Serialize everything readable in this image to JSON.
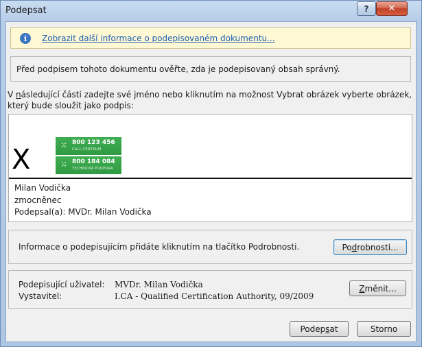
{
  "window": {
    "title": "Podepsat",
    "help_label": "?",
    "close_label": "✕"
  },
  "info_bar": {
    "icon": "info-icon",
    "icon_glyph": "i",
    "link_text": "Zobrazit další informace o podepisovaném dokumentu..."
  },
  "verify_text": "Před podpisem tohoto dokumentu ověřte, zda je podepisovaný obsah správný.",
  "instructions": {
    "prefix": "V ",
    "underlined": "n",
    "rest": "ásledující části zadejte své jméno nebo kliknutím na možnost Vybrat obrázek vyberte obrázek, který bude sloužit jako podpis:"
  },
  "signature": {
    "x_mark": "X",
    "image": {
      "top_number": "800 123 456",
      "top_caption": "CALL CENTRUM",
      "bottom_number": "800 184 084",
      "bottom_caption": "TECHNICKÁ PODPORA",
      "color": "#33a148"
    },
    "lines": [
      "Milan Vodička",
      "zmocněnec",
      "Podepsal(a): MVDr. Milan Vodička"
    ]
  },
  "details": {
    "text": "Informace o podepisujícím přidáte kliknutím na tlačítko Podrobnosti.",
    "button_pre": "Po",
    "button_ul": "d",
    "button_post": "robnosti..."
  },
  "certificate": {
    "signer_label": "Podepisující uživatel:",
    "signer_value": "MVDr. Milan Vodička",
    "issuer_label": "Vystavitel:",
    "issuer_value": "I.CA - Qualified Certification Authority, 09/2009",
    "change_pre": "",
    "change_ul": "Z",
    "change_post": "měnit..."
  },
  "footer": {
    "sign_pre": "Podep",
    "sign_ul": "s",
    "sign_post": "at",
    "cancel_label": "Storno"
  },
  "colors": {
    "link": "#1b5fae",
    "info_bg": "#fff8d5",
    "close_button": "#c94a30"
  }
}
